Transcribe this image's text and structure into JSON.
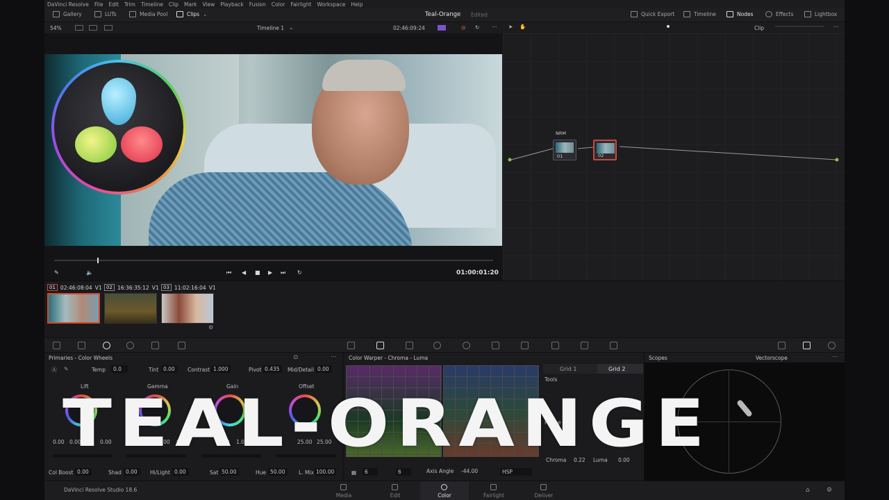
{
  "menu": [
    "DaVinci Resolve",
    "File",
    "Edit",
    "Trim",
    "Timeline",
    "Clip",
    "Mark",
    "View",
    "Playback",
    "Fusion",
    "Color",
    "Fairlight",
    "Workspace",
    "Help"
  ],
  "toolbar": {
    "gallery": "Gallery",
    "luts": "LUTs",
    "media_pool": "Media Pool",
    "clips": "Clips",
    "project_title": "Teal-Orange",
    "project_status": "Edited",
    "quick_export": "Quick Export",
    "timeline": "Timeline",
    "nodes": "Nodes",
    "effects": "Effects",
    "lightbox": "Lightbox"
  },
  "viewer": {
    "zoom": "54%",
    "timeline_name": "Timeline 1",
    "timecode": "02:46:09:24",
    "playhead_timecode": "01:00:01:20"
  },
  "node_panel": {
    "mode": "Clip",
    "nodes": [
      {
        "label": "NRM",
        "number": "01"
      },
      {
        "label": "",
        "number": "02"
      }
    ]
  },
  "clips": [
    {
      "number": "01",
      "timecode": "02:46:08:04",
      "track": "V1"
    },
    {
      "number": "02",
      "timecode": "16:36:35:12",
      "track": "V1"
    },
    {
      "number": "03",
      "timecode": "11:02:16:04",
      "track": "V1"
    }
  ],
  "primaries": {
    "title": "Primaries - Color Wheels",
    "temp_label": "Temp",
    "temp_value": "0.0",
    "tint_label": "Tint",
    "tint_value": "0.00",
    "contrast_label": "Contrast",
    "contrast_value": "1.000",
    "pivot_label": "Pivot",
    "pivot_value": "0.435",
    "middetail_label": "Mid/Detail",
    "middetail_value": "0.00",
    "wheels": [
      {
        "label": "Lift",
        "values": [
          "0.00",
          "0.00",
          "0.00"
        ]
      },
      {
        "label": "Gamma",
        "values": [
          "0.00",
          "0.00",
          "0.00"
        ]
      },
      {
        "label": "Gain",
        "values": [
          "1.00",
          "1.00",
          "1.00"
        ]
      },
      {
        "label": "Offset",
        "values": [
          "25.00",
          "25.00",
          "25.00"
        ]
      }
    ],
    "colboost_label": "Col Boost",
    "colboost_value": "0.00",
    "shad_label": "Shad",
    "shad_value": "0.00",
    "hilight_label": "Hi/Light",
    "hilight_value": "0.00",
    "sat_label": "Sat",
    "sat_value": "50.00",
    "hue_label": "Hue",
    "hue_value": "50.00",
    "lmix_label": "L. Mix",
    "lmix_value": "100.00"
  },
  "warper": {
    "title": "Color Warper - Chroma - Luma",
    "grid1": "Grid 1",
    "grid2": "Grid 2",
    "tools": "Tools",
    "range": "Range",
    "chroma_label": "Chroma",
    "chroma_value": "0.22",
    "luma_label": "Luma",
    "luma_value": "0.00",
    "axis_label": "Axis Angle",
    "axis_value": "-44.00",
    "space": "HSP",
    "res1": "6",
    "res2": "6"
  },
  "scopes": {
    "title": "Scopes",
    "type": "Vectorscope"
  },
  "pages": [
    "Media",
    "Edit",
    "Color",
    "Fairlight",
    "Deliver"
  ],
  "footer": {
    "app_name": "DaVinci Resolve Studio 18.6"
  },
  "overlay": {
    "text": "TEAL-ORANGE"
  }
}
